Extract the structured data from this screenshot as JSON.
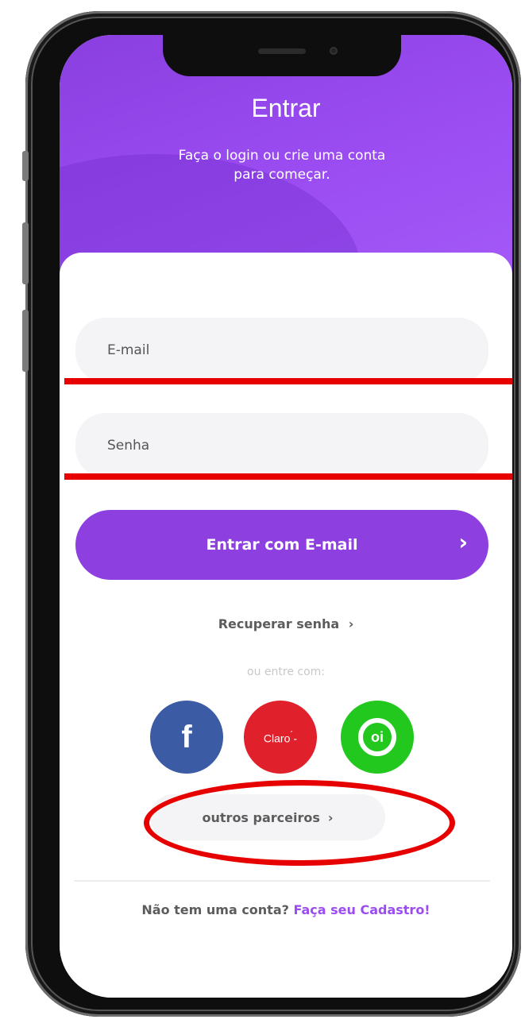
{
  "header": {
    "title": "Entrar",
    "subtitle": "Faça o login ou crie uma conta para começar."
  },
  "form": {
    "email_placeholder": "E-mail",
    "password_placeholder": "Senha",
    "submit_label": "Entrar com E-mail",
    "submit_icon": "chevron-right-icon"
  },
  "recover": {
    "label": "Recuperar senha",
    "icon": "chevron-right-icon"
  },
  "social": {
    "divider_text": "ou entre com:",
    "providers": [
      {
        "name": "facebook",
        "label": "f",
        "color": "#3b5ba5"
      },
      {
        "name": "claro",
        "label": "Claro",
        "color": "#e0202a"
      },
      {
        "name": "oi",
        "label": "oi",
        "color": "#22c81e"
      }
    ],
    "partners_label": "outros parceiros"
  },
  "footer": {
    "question": "Não tem uma conta?",
    "cta": "Faça seu Cadastro!"
  },
  "colors": {
    "brand_purple": "#8d3fe0",
    "annotation_red": "#e60000"
  }
}
